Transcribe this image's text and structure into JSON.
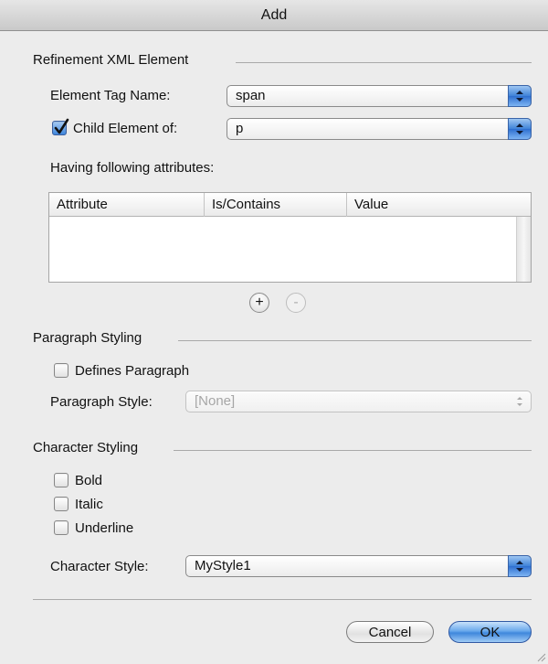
{
  "window": {
    "title": "Add"
  },
  "refinement": {
    "section_title": "Refinement XML Element",
    "tag_name_label": "Element Tag Name:",
    "tag_name_value": "span",
    "child_label": "Child Element of:",
    "child_checked": true,
    "child_value": "p",
    "attributes_label": "Having following attributes:",
    "columns": [
      "Attribute",
      "Is/Contains",
      "Value"
    ],
    "add_button": "+",
    "remove_button": "-"
  },
  "paragraph": {
    "section_title": "Paragraph Styling",
    "defines_label": "Defines Paragraph",
    "defines_checked": false,
    "style_label": "Paragraph Style:",
    "style_value": "[None]"
  },
  "character": {
    "section_title": "Character Styling",
    "bold_label": "Bold",
    "italic_label": "Italic",
    "underline_label": "Underline",
    "style_label": "Character Style:",
    "style_value": "MyStyle1"
  },
  "buttons": {
    "cancel": "Cancel",
    "ok": "OK"
  },
  "icons": {
    "popup_arrow": "updown-arrows-icon",
    "check": "checkmark-icon",
    "resize": "resize-grip-icon"
  },
  "colors": {
    "accent": "#3e82d8",
    "window_bg": "#ececec"
  }
}
